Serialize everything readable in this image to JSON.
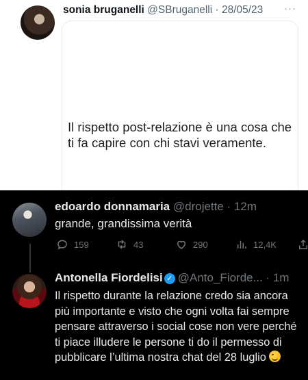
{
  "tweet_top": {
    "author_name": "sonia bruganelli",
    "meta": "@SBruganelli · 28/05/23",
    "more": "···",
    "text": "Il rispetto post-relazione è una cosa che ti fa capire con chi stavi veramente."
  },
  "reply1": {
    "author_name": "edoardo donnamaria",
    "meta": "@drojette · 12m",
    "text": "grande, grandissima verità",
    "replies": "159",
    "retweets": "43",
    "likes": "290",
    "views": "12,4K"
  },
  "reply2": {
    "author_name": "Antonella Fiordelisi",
    "meta": "@Anto_Fiorde... · 1m",
    "text": "Il rispetto durante la relazione credo sia ancora più importante e visto che ogni volta fai sempre pensare attraverso i social cose non vere perché ti piace illudere le persone ti do il permesso di pubblicare l’ultima nostra chat del 28 luglio"
  },
  "icons": {
    "reply": "reply-icon",
    "retweet": "retweet-icon",
    "like": "like-icon",
    "views": "views-icon",
    "share": "share-icon",
    "verified": "verified-badge-icon",
    "emoji": "wink-emoji-icon"
  },
  "colors": {
    "dark_bg": "#000000",
    "muted": "#71767b",
    "verified": "#1d9bf0"
  }
}
